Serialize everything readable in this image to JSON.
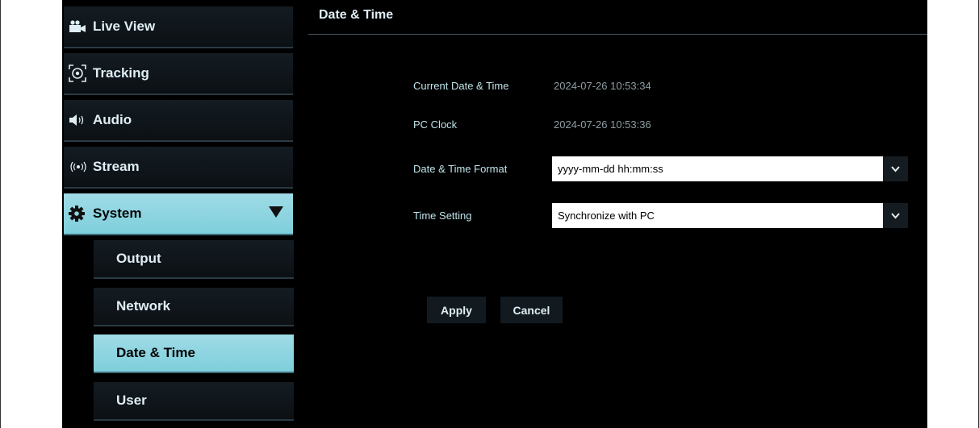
{
  "sidebar": {
    "items": [
      {
        "label": "Live View",
        "icon": "video-camera-icon"
      },
      {
        "label": "Tracking",
        "icon": "tracking-icon"
      },
      {
        "label": "Audio",
        "icon": "speaker-icon"
      },
      {
        "label": "Stream",
        "icon": "broadcast-icon"
      },
      {
        "label": "System",
        "icon": "gear-icon",
        "expanded": true
      }
    ],
    "subitems": [
      {
        "label": "Output"
      },
      {
        "label": "Network"
      },
      {
        "label": "Date & Time",
        "selected": true
      },
      {
        "label": "User"
      }
    ]
  },
  "main": {
    "title": "Date & Time",
    "fields": {
      "current_label": "Current Date & Time",
      "current_value": "2024-07-26 10:53:34",
      "pc_clock_label": "PC Clock",
      "pc_clock_value": "2024-07-26 10:53:36",
      "format_label": "Date & Time Format",
      "format_value": "yyyy-mm-dd hh:mm:ss",
      "time_setting_label": "Time Setting",
      "time_setting_value": "Synchronize with PC"
    },
    "buttons": {
      "apply": "Apply",
      "cancel": "Cancel"
    }
  },
  "colors": {
    "accent": "#8fd6e2",
    "background": "#000000",
    "label_text": "#bfe3ea",
    "value_text": "#8d9ea4"
  }
}
